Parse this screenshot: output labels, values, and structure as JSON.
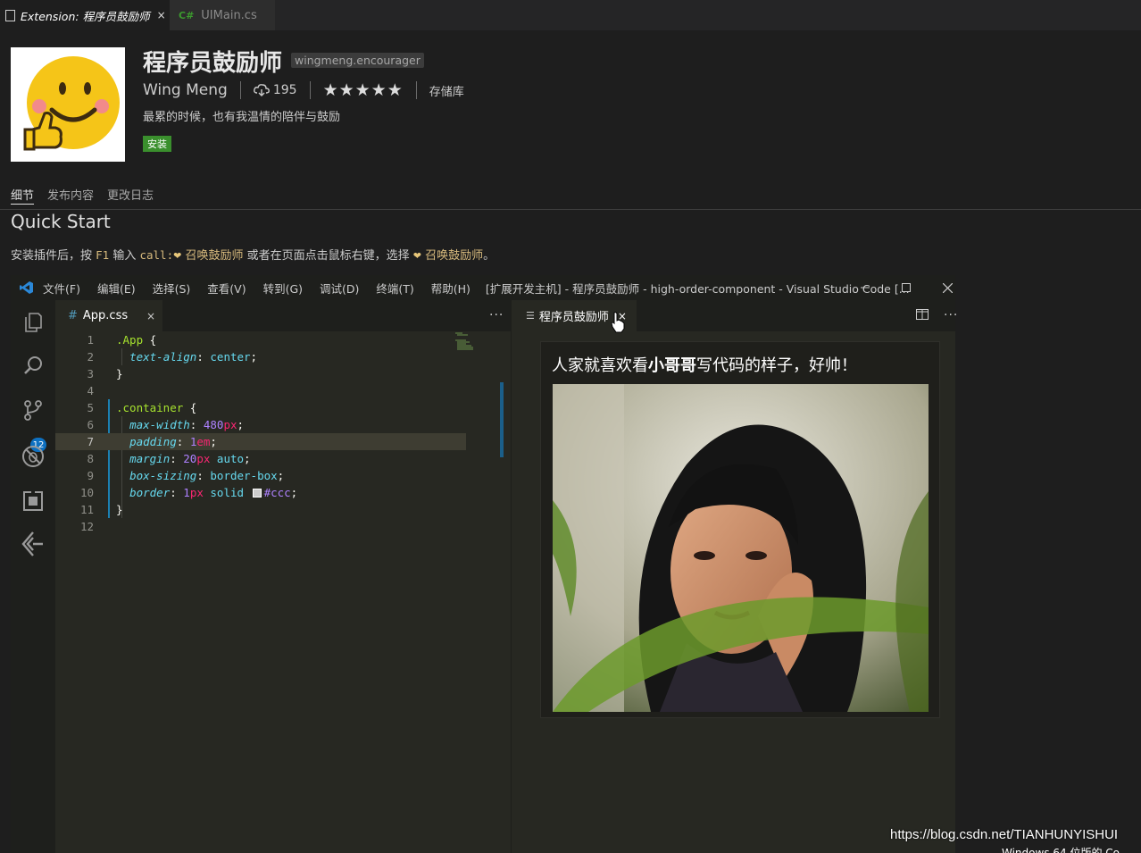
{
  "outer_tabs": [
    {
      "prefix": "Extension:",
      "title": "程序员鼓励师",
      "close": "×"
    },
    {
      "lang": "C#",
      "title": "UIMain.cs"
    }
  ],
  "extension": {
    "name": "程序员鼓励师",
    "id": "wingmeng.encourager",
    "author": "Wing Meng",
    "downloads": "195",
    "stars": "★★★★★",
    "repository": "存储库",
    "description": "最累的时候，也有我温情的陪伴与鼓励",
    "install_label": "安装"
  },
  "detail_nav": [
    "细节",
    "发布内容",
    "更改日志"
  ],
  "readme": {
    "heading": "Quick Start",
    "instr_1": "安装插件后，按 ",
    "key": "F1",
    "instr_2": " 输入 ",
    "command": "call:",
    "link_1": " 召唤鼓励师",
    "instr_3": " 或者在页面点击鼠标右键，选择 ",
    "link_2": " 召唤鼓励师",
    "instr_4": "。",
    "heart": "❤"
  },
  "vscode": {
    "menu": [
      "文件(F)",
      "编辑(E)",
      "选择(S)",
      "查看(V)",
      "转到(G)",
      "调试(D)",
      "终端(T)",
      "帮助(H)"
    ],
    "window_title": "[扩展开发主机] - 程序员鼓励师 - high-order-component - Visual Studio Code [...",
    "scm_badge": "12",
    "editor_tab": "App.css",
    "editor_tab_icon": "#",
    "close": "×",
    "more": "···",
    "line_numbers": [
      "1",
      "2",
      "3",
      "4",
      "5",
      "6",
      "7",
      "8",
      "9",
      "10",
      "11",
      "12"
    ],
    "code": {
      "l1_sel": ".App",
      "l1_brace": " {",
      "l2_prop": "text-align",
      "l2_val": "center",
      "l3": "}",
      "l5_sel": ".container",
      "l5_brace": " {",
      "l6_prop": "max-width",
      "l6_num": "480",
      "l6_unit": "px",
      "l7_prop": "padding",
      "l7_num": "1",
      "l7_unit": "em",
      "l8_prop": "margin",
      "l8_num": "20",
      "l8_unit": "px",
      "l8_val": " auto",
      "l9_prop": "box-sizing",
      "l9_val": "border-box",
      "l10_prop": "border",
      "l10_num": "1",
      "l10_unit": "px",
      "l10_val": " solid ",
      "l10_color": "#ccc",
      "l11": "}"
    },
    "preview_tab": "程序员鼓励师",
    "preview_text_1": "人家就喜欢看",
    "preview_text_bold": "小哥哥",
    "preview_text_2": "写代码的样子，好帅！"
  },
  "watermark": "https://blog.csdn.net/TIANHUNYISHUI",
  "toast": "Windows 64 位版的 Co"
}
